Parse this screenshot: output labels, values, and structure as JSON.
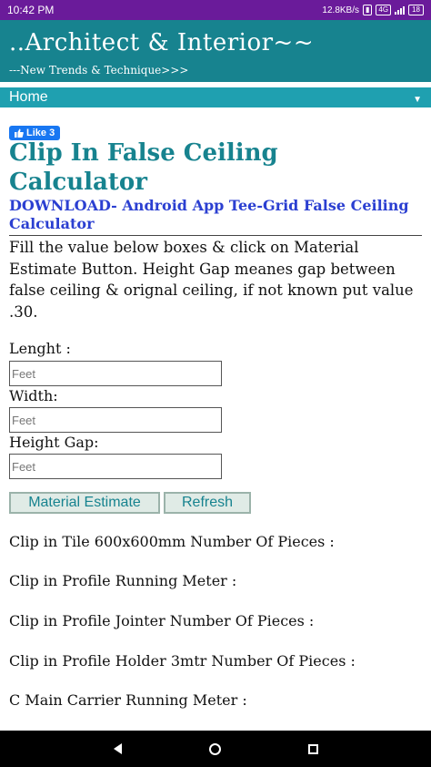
{
  "status_bar": {
    "time": "10:42 PM",
    "network_speed": "12.8KB/s",
    "badge": "4G",
    "battery": "18"
  },
  "site": {
    "title": "..Architect & Interior~~",
    "tagline": "---New Trends & Technique>>>"
  },
  "nav": {
    "home_label": "Home",
    "arrow": "▼"
  },
  "like": {
    "label": "Like 3"
  },
  "page": {
    "title": "Clip In False Ceiling Calculator",
    "download_link": "DOWNLOAD- Android App Tee-Grid False Ceiling Calculator",
    "intro": "Fill the value below boxes & click on Material Estimate Button. Height Gap meanes gap between false ceiling & orignal ceiling, if not known put value .30."
  },
  "form": {
    "length_label": "Lenght :",
    "length_placeholder": "Feet",
    "width_label": "Width:",
    "width_placeholder": "Feet",
    "height_gap_label": "Height Gap:",
    "height_gap_placeholder": "Feet",
    "estimate_button": "Material Estimate",
    "refresh_button": "Refresh"
  },
  "results": [
    "Clip in Tile 600x600mm Number Of Pieces :",
    "Clip in Profile Running Meter :",
    "Clip in Profile Jointer Number Of Pieces :",
    "Clip in Profile Holder 3mtr Number Of Pieces :",
    "C Main Carrier Running Meter :"
  ],
  "icons": {
    "like": "thumbs-up-icon",
    "nav_back": "back-triangle-icon",
    "nav_home": "home-circle-icon",
    "nav_recent": "recent-square-icon"
  },
  "colors": {
    "status_bar": "#6a1b9a",
    "header": "#17838f",
    "nav": "#1fa0b0",
    "title": "#17838f",
    "link": "#2b3fd1",
    "like": "#1877f2"
  }
}
